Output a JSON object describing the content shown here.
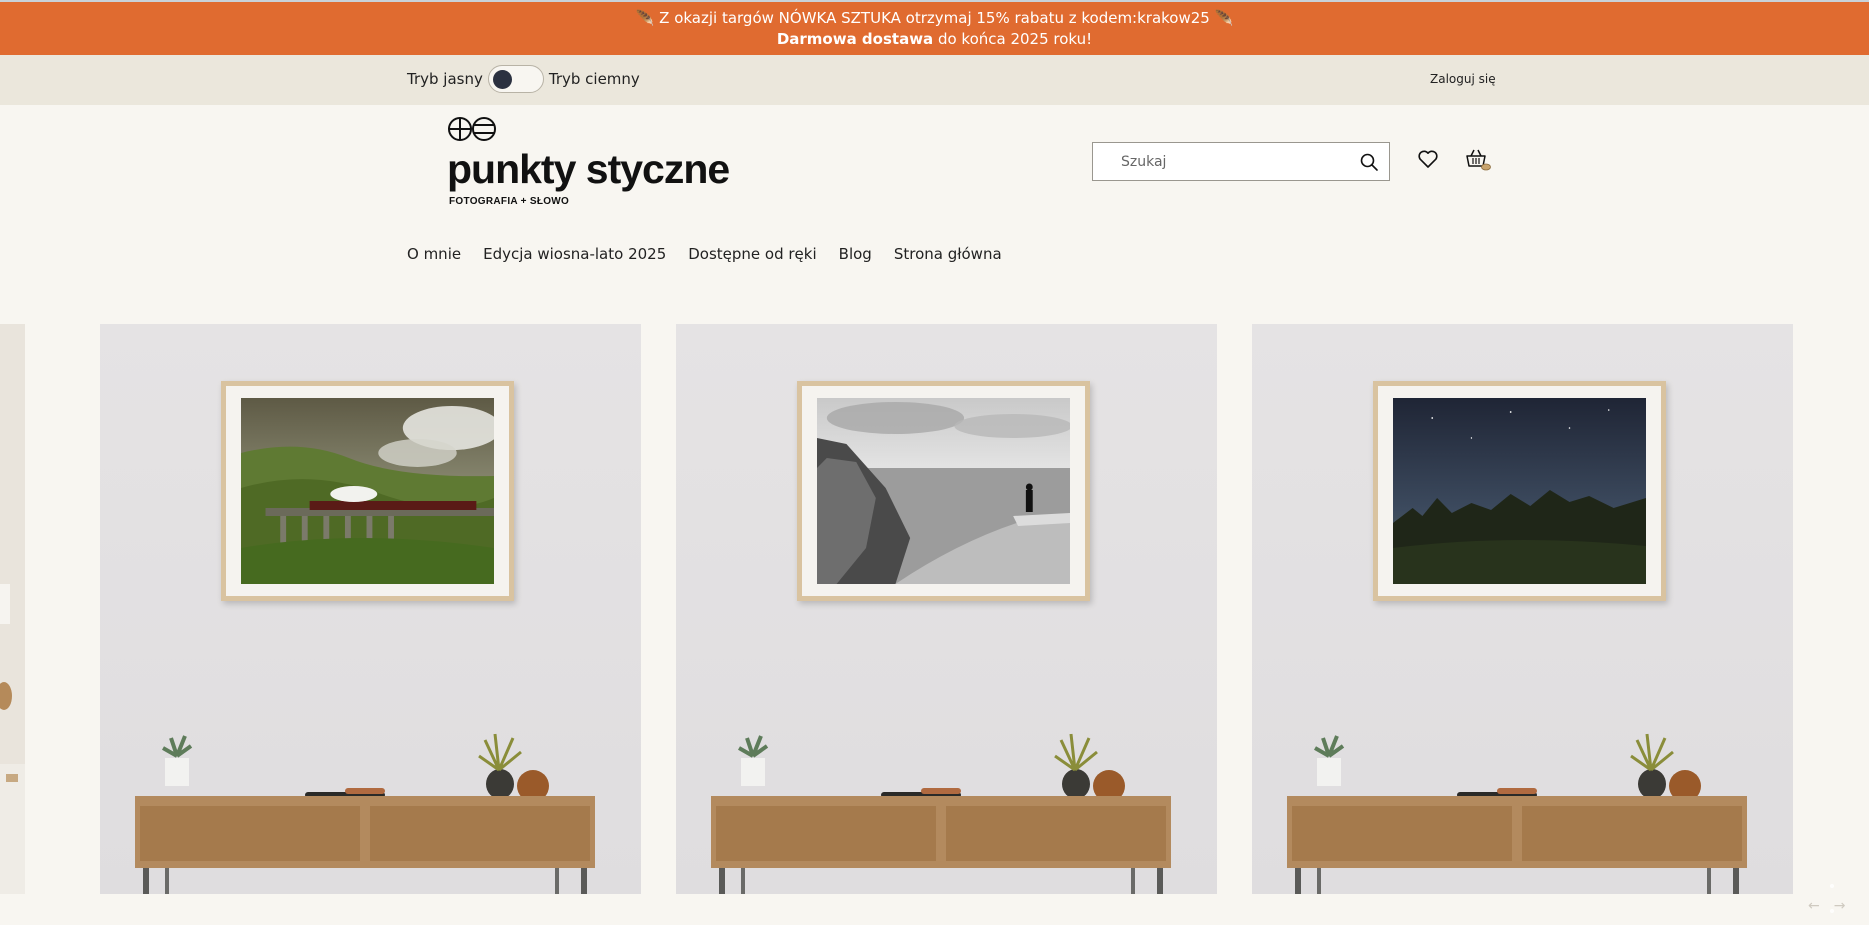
{
  "announcement": {
    "line1": "🪶 Z okazji targów NÓWKA SZTUKA otrzymaj 15% rabatu z kodem:krakow25 🪶",
    "line2_bold": "Darmowa dostawa",
    "line2_rest": " do końca 2025 roku!"
  },
  "utility": {
    "light_mode_label": "Tryb jasny",
    "dark_mode_label": "Tryb ciemny",
    "login_label": "Zaloguj się"
  },
  "brand": {
    "name": "punkty styczne",
    "tagline": "FOTOGRAFIA + SŁOWO"
  },
  "search": {
    "placeholder": "Szukaj",
    "value": ""
  },
  "icons": {
    "search": "search-icon",
    "wishlist": "heart-icon",
    "cart": "basket-icon",
    "logo": "logo-mark-icon"
  },
  "nav": {
    "items": [
      {
        "label": "O mnie"
      },
      {
        "label": "Edycja wiosna-lato 2025"
      },
      {
        "label": "Dostępne od ręki"
      },
      {
        "label": "Blog"
      },
      {
        "label": "Strona główna"
      }
    ]
  },
  "carousel": {
    "slides": [
      {
        "photo": "green viaduct with steam train"
      },
      {
        "photo": "black and white coastal cliff with figure"
      },
      {
        "photo": "night sky over forest"
      }
    ],
    "arrows": {
      "prev": "←",
      "next": "→"
    }
  },
  "colors": {
    "announcement_bg": "#e06b30",
    "utility_bg": "#ebe7dc",
    "page_bg": "#f8f6f1"
  }
}
